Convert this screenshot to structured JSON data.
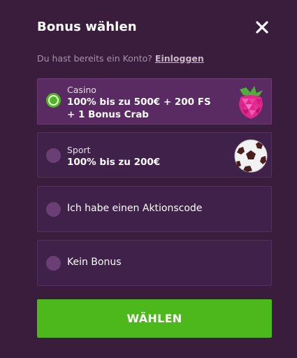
{
  "header": {
    "title": "Bonus wählen",
    "close_icon": "close-icon"
  },
  "account": {
    "prompt": "Du hast bereits ein Konto?",
    "login_label": "Einloggen"
  },
  "options": [
    {
      "category": "Casino",
      "line1": "100% bis zu 500€ + 200 FS",
      "line2": "+ 1 Bonus Crab",
      "selected": true,
      "icon": "raspberry-icon"
    },
    {
      "category": "Sport",
      "line1": "100% bis zu 200€",
      "selected": false,
      "icon": "soccer-ball-icon"
    },
    {
      "label": "Ich habe einen Aktionscode",
      "selected": false
    },
    {
      "label": "Kein Bonus",
      "selected": false
    }
  ],
  "cta": {
    "label": "WÄHLEN"
  },
  "colors": {
    "background": "#3a1d3d",
    "option_bg": "#40214a",
    "option_selected_bg": "#5a2a63",
    "accent_green": "#4cb81c"
  }
}
